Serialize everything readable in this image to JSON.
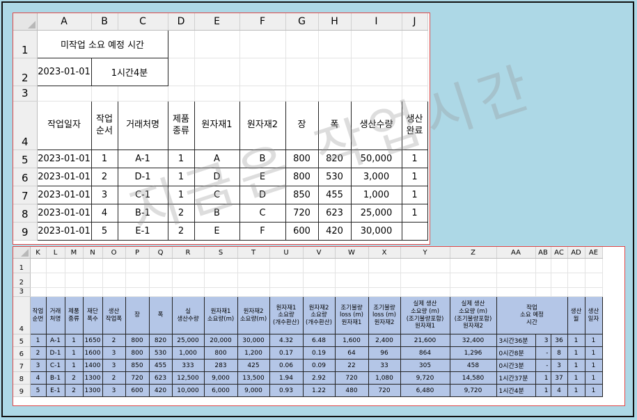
{
  "watermark": "지금은 작업시간",
  "sheet1": {
    "columns": [
      "A",
      "B",
      "C",
      "D",
      "E",
      "F",
      "G",
      "H",
      "I",
      "J"
    ],
    "rows": [
      "1",
      "2",
      "3",
      "4",
      "5",
      "6",
      "7",
      "8",
      "9"
    ],
    "title": "미작업 소요 예정 시간",
    "date": "2023-01-01",
    "duration": "1시간4분",
    "headers": [
      "작업일자",
      "작업\n순서",
      "거래처명",
      "제품\n종류",
      "원자재1",
      "원자재2",
      "장",
      "폭",
      "생산수량",
      "생산\n완료"
    ],
    "data": [
      [
        "2023-01-01",
        "1",
        "A-1",
        "1",
        "A",
        "B",
        "800",
        "820",
        "50,000",
        "1"
      ],
      [
        "2023-01-01",
        "2",
        "D-1",
        "1",
        "D",
        "E",
        "800",
        "530",
        "3,000",
        "1"
      ],
      [
        "2023-01-01",
        "3",
        "C-1",
        "1",
        "C",
        "D",
        "850",
        "455",
        "1,000",
        "1"
      ],
      [
        "2023-01-01",
        "4",
        "B-1",
        "2",
        "B",
        "C",
        "720",
        "623",
        "25,000",
        "1"
      ],
      [
        "2023-01-01",
        "5",
        "E-1",
        "2",
        "E",
        "F",
        "600",
        "420",
        "30,000",
        ""
      ]
    ]
  },
  "sheet2": {
    "columns": [
      "K",
      "L",
      "M",
      "N",
      "O",
      "P",
      "Q",
      "R",
      "S",
      "T",
      "U",
      "V",
      "W",
      "X",
      "Y",
      "Z",
      "AA",
      "AB",
      "AC",
      "AD",
      "AE"
    ],
    "rows": [
      "1",
      "2",
      "3",
      "4",
      "5",
      "6",
      "7",
      "8",
      "9"
    ],
    "headers": [
      "작업\n순번",
      "거래\n처명",
      "제품\n종류",
      "재단\n폭수",
      "생산\n작업폭",
      "장",
      "폭",
      "실\n생산수량",
      "원자재1\n소요량(m)",
      "원자재2\n소요량(m)",
      "원자재1\n소요량\n(개수환산)",
      "원자재2\n소요량\n(개수환산)",
      "조기불량\nloss (m)\n원자재1",
      "조기불량\nloss (m)\n원자재2",
      "실제 생산\n소요량 (m)\n(조기불량포함)\n원자재1",
      "실제 생산\n소요량 (m)\n(조기불량포함)\n원자재2",
      "작업\n소요 예정\n시간",
      "생산\n월",
      "생산\n일자"
    ],
    "data": [
      [
        "1",
        "A-1",
        "1",
        "1650",
        "2",
        "800",
        "820",
        "25,000",
        "20,000",
        "30,000",
        "4.32",
        "6.48",
        "1,600",
        "2,400",
        "21,600",
        "32,400",
        "3시간36분",
        "3",
        "36",
        "1",
        "1"
      ],
      [
        "2",
        "D-1",
        "1",
        "1600",
        "3",
        "800",
        "530",
        "1,000",
        "800",
        "1,200",
        "0.17",
        "0.19",
        "64",
        "96",
        "864",
        "1,296",
        "0시간8분",
        "-",
        "8",
        "1",
        "1"
      ],
      [
        "3",
        "C-1",
        "1",
        "1400",
        "3",
        "850",
        "455",
        "333",
        "283",
        "425",
        "0.06",
        "0.09",
        "22",
        "33",
        "305",
        "458",
        "0시간3분",
        "-",
        "3",
        "1",
        "1"
      ],
      [
        "4",
        "B-1",
        "2",
        "1300",
        "2",
        "720",
        "623",
        "12,500",
        "9,000",
        "13,500",
        "1.94",
        "2.92",
        "720",
        "1,080",
        "9,720",
        "14,580",
        "1시간37분",
        "1",
        "37",
        "1",
        "1"
      ],
      [
        "5",
        "E-1",
        "2",
        "1300",
        "3",
        "600",
        "420",
        "10,000",
        "6,000",
        "9,000",
        "0.93",
        "1.22",
        "480",
        "720",
        "6,480",
        "9,720",
        "1시간4분",
        "1",
        "4",
        "1",
        "1"
      ]
    ]
  }
}
